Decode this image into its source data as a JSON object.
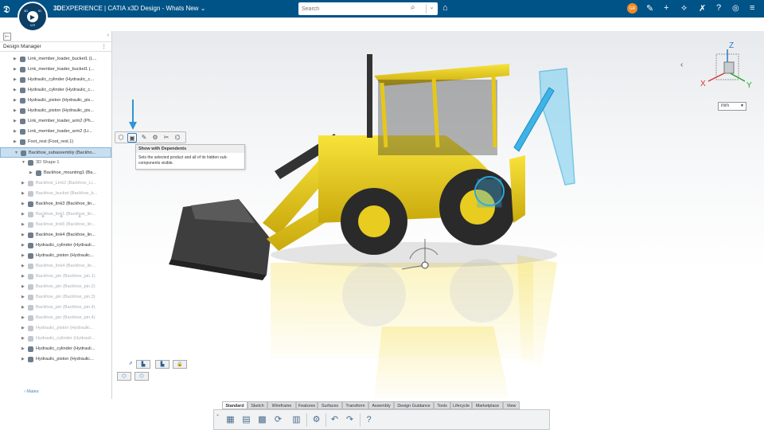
{
  "header": {
    "brand_bold": "3D",
    "brand_rest": "EXPERIENCE | CATIA",
    "app_name": "x3D Design - Whats New",
    "title_chevron": "⌄",
    "compass_top": "3D",
    "compass_right": "ID",
    "compass_bottom": "V,R",
    "ds_logo": "𝕯",
    "search_placeholder": "Search",
    "avatar_initials": "GR",
    "icons": [
      "tag-icon",
      "share-icon",
      "add-icon",
      "network-icon",
      "tools-icon",
      "help-icon",
      "menu-icon"
    ]
  },
  "panel": {
    "title": "Design Manager",
    "more_label": "⋮",
    "collapse_label": "‹",
    "tree_icon": "⊢",
    "rows": [
      {
        "text": "Link_member_loader_bucket1 (L...",
        "indent": 0,
        "state": "normal"
      },
      {
        "text": "Link_member_loader_bucket1 (...",
        "indent": 0,
        "state": "normal"
      },
      {
        "text": "Hydraulic_cylinder (Hydraulic_c...",
        "indent": 0,
        "state": "normal"
      },
      {
        "text": "Hydraulic_cylinder (Hydraulic_c...",
        "indent": 0,
        "state": "normal"
      },
      {
        "text": "Hydraulic_piston (Hydraulic_pis...",
        "indent": 0,
        "state": "normal"
      },
      {
        "text": "Hydraulic_piston (Hydraulic_pis...",
        "indent": 0,
        "state": "normal"
      },
      {
        "text": "Link_member_loader_arm2 (Ph...",
        "indent": 0,
        "state": "normal"
      },
      {
        "text": "Link_member_loader_arm2 (Li...",
        "indent": 0,
        "state": "normal"
      },
      {
        "text": "Foot_rest (Foot_rest.1)",
        "indent": 0,
        "state": "normal"
      },
      {
        "text": "Backhoe_subassembly (Backho...",
        "indent": 0,
        "state": "selected"
      },
      {
        "text": "3D Shape 1",
        "indent": 1,
        "state": "sub"
      },
      {
        "text": "Backhoe_mounting1 (Ba...",
        "indent": 2,
        "state": "normal"
      },
      {
        "text": "Backhoe_Link2 (Backhoe_Li...",
        "indent": 1,
        "state": "hidden"
      },
      {
        "text": "Backhoe_bucket (Backhoe_b...",
        "indent": 1,
        "state": "hidden"
      },
      {
        "text": "Backhoe_link3 (Backhoe_lin...",
        "indent": 1,
        "state": "normal"
      },
      {
        "text": "Backhoe_link1 (Backhoe_lin...",
        "indent": 1,
        "state": "hidden"
      },
      {
        "text": "Backhoe_link5 (Backhoe_lin...",
        "indent": 1,
        "state": "hidden"
      },
      {
        "text": "Backhoe_link4 (Backhoe_lin...",
        "indent": 1,
        "state": "normal"
      },
      {
        "text": "Hydraulic_cylinder (Hydrauli...",
        "indent": 1,
        "state": "normal"
      },
      {
        "text": "Hydraulic_piston (Hydraulic...",
        "indent": 1,
        "state": "normal"
      },
      {
        "text": "Backhoe_link4 (Backhoe_lin...",
        "indent": 1,
        "state": "hidden"
      },
      {
        "text": "Backhoe_pin (Backhoe_pin.1)",
        "indent": 1,
        "state": "hidden"
      },
      {
        "text": "Backhoe_pin (Backhoe_pin.2)",
        "indent": 1,
        "state": "hidden"
      },
      {
        "text": "Backhoe_pin (Backhoe_pin.3)",
        "indent": 1,
        "state": "hidden"
      },
      {
        "text": "Backhoe_pin (Backhoe_pin.4)",
        "indent": 1,
        "state": "hidden"
      },
      {
        "text": "Backhoe_pin (Backhoe_pin.4)",
        "indent": 1,
        "state": "hidden"
      },
      {
        "text": "Hydraulic_piston (Hydraulic...",
        "indent": 1,
        "state": "hidden"
      },
      {
        "text": "Hydraulic_cylinder (Hydrauli...",
        "indent": 1,
        "state": "hidden"
      },
      {
        "text": "Hydraulic_cylinder (Hydrauli...",
        "indent": 1,
        "state": "normal"
      },
      {
        "text": "Hydraulic_piston (Hydraulic...",
        "indent": 1,
        "state": "normal"
      }
    ],
    "mates": "Mates"
  },
  "tooltip": {
    "title": "Show with Dependents",
    "description": "Sets the selected product and all of its hidden sub-components visible."
  },
  "compass_widget": {
    "x": "X",
    "y": "Y",
    "z": "Z"
  },
  "units": {
    "value": "mm"
  },
  "colors": {
    "header": "#005386",
    "accent": "#2b7bc0",
    "vehicle": "#f1d51b",
    "highlight": "#3fb3e6"
  },
  "action_bar": {
    "tabs": [
      "Standard",
      "Sketch",
      "Wireframe",
      "Features",
      "Surfaces",
      "Transform",
      "Assembly",
      "Design Guidance",
      "Tools",
      "Lifecycle",
      "Marketplace",
      "View"
    ],
    "active_tab": "Standard"
  }
}
